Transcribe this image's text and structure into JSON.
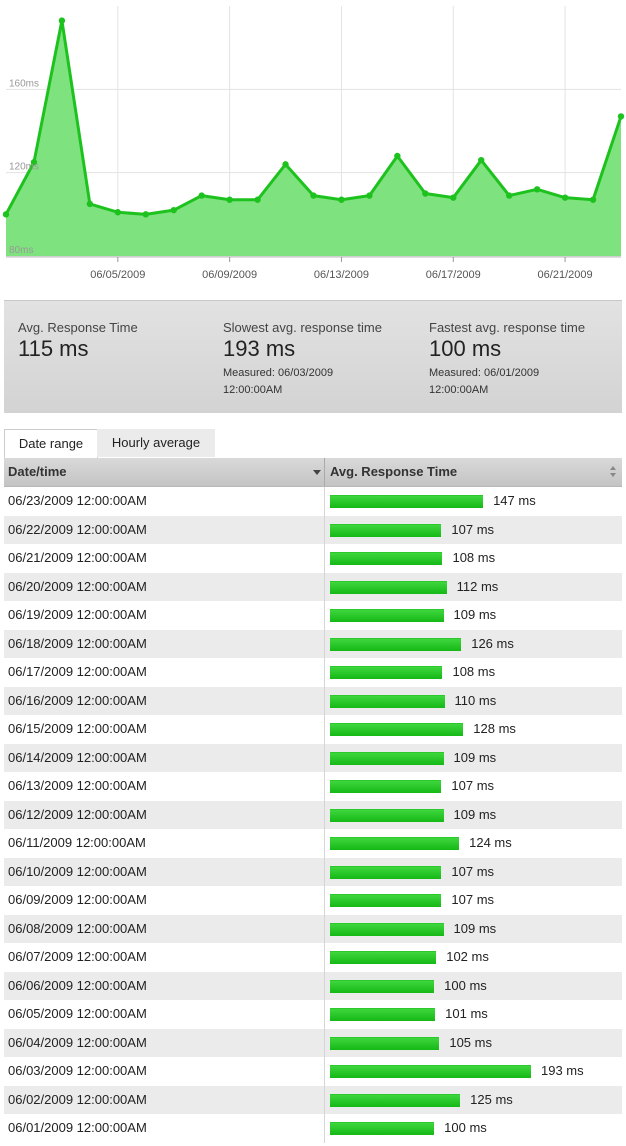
{
  "chart_data": {
    "type": "area",
    "x": [
      "06/01/2009",
      "06/02/2009",
      "06/03/2009",
      "06/04/2009",
      "06/05/2009",
      "06/06/2009",
      "06/07/2009",
      "06/08/2009",
      "06/09/2009",
      "06/10/2009",
      "06/11/2009",
      "06/12/2009",
      "06/13/2009",
      "06/14/2009",
      "06/15/2009",
      "06/16/2009",
      "06/17/2009",
      "06/18/2009",
      "06/19/2009",
      "06/20/2009",
      "06/21/2009",
      "06/22/2009",
      "06/23/2009"
    ],
    "values": [
      100,
      125,
      193,
      105,
      101,
      100,
      102,
      109,
      107,
      107,
      124,
      109,
      107,
      109,
      128,
      110,
      108,
      126,
      109,
      112,
      108,
      107,
      147
    ],
    "xtick_labels": [
      "06/05/2009",
      "06/09/2009",
      "06/13/2009",
      "06/17/2009",
      "06/21/2009"
    ],
    "ytick_labels": [
      "80ms",
      "120ms",
      "160ms"
    ],
    "ylim": [
      80,
      200
    ],
    "grid": true,
    "colors": {
      "line": "#1ec21e",
      "fill": "#7ee27e"
    }
  },
  "summary": {
    "avg": {
      "label": "Avg. Response Time",
      "value": "115 ms"
    },
    "slowest": {
      "label": "Slowest avg. response time",
      "value": "193 ms",
      "measured": "Measured: 06/03/2009",
      "time": "12:00:00AM"
    },
    "fastest": {
      "label": "Fastest avg. response time",
      "value": "100 ms",
      "measured": "Measured: 06/01/2009",
      "time": "12:00:00AM"
    }
  },
  "tabs": {
    "date_range": "Date range",
    "hourly_average": "Hourly average"
  },
  "table": {
    "headers": {
      "datetime": "Date/time",
      "avg": "Avg. Response Time"
    },
    "rows": [
      {
        "date": "06/23/2009 12:00:00AM",
        "value": 147,
        "label": "147 ms"
      },
      {
        "date": "06/22/2009 12:00:00AM",
        "value": 107,
        "label": "107 ms"
      },
      {
        "date": "06/21/2009 12:00:00AM",
        "value": 108,
        "label": "108 ms"
      },
      {
        "date": "06/20/2009 12:00:00AM",
        "value": 112,
        "label": "112 ms"
      },
      {
        "date": "06/19/2009 12:00:00AM",
        "value": 109,
        "label": "109 ms"
      },
      {
        "date": "06/18/2009 12:00:00AM",
        "value": 126,
        "label": "126 ms"
      },
      {
        "date": "06/17/2009 12:00:00AM",
        "value": 108,
        "label": "108 ms"
      },
      {
        "date": "06/16/2009 12:00:00AM",
        "value": 110,
        "label": "110 ms"
      },
      {
        "date": "06/15/2009 12:00:00AM",
        "value": 128,
        "label": "128 ms"
      },
      {
        "date": "06/14/2009 12:00:00AM",
        "value": 109,
        "label": "109 ms"
      },
      {
        "date": "06/13/2009 12:00:00AM",
        "value": 107,
        "label": "107 ms"
      },
      {
        "date": "06/12/2009 12:00:00AM",
        "value": 109,
        "label": "109 ms"
      },
      {
        "date": "06/11/2009 12:00:00AM",
        "value": 124,
        "label": "124 ms"
      },
      {
        "date": "06/10/2009 12:00:00AM",
        "value": 107,
        "label": "107 ms"
      },
      {
        "date": "06/09/2009 12:00:00AM",
        "value": 107,
        "label": "107 ms"
      },
      {
        "date": "06/08/2009 12:00:00AM",
        "value": 109,
        "label": "109 ms"
      },
      {
        "date": "06/07/2009 12:00:00AM",
        "value": 102,
        "label": "102 ms"
      },
      {
        "date": "06/06/2009 12:00:00AM",
        "value": 100,
        "label": "100 ms"
      },
      {
        "date": "06/05/2009 12:00:00AM",
        "value": 101,
        "label": "101 ms"
      },
      {
        "date": "06/04/2009 12:00:00AM",
        "value": 105,
        "label": "105 ms"
      },
      {
        "date": "06/03/2009 12:00:00AM",
        "value": 193,
        "label": "193 ms"
      },
      {
        "date": "06/02/2009 12:00:00AM",
        "value": 125,
        "label": "125 ms"
      },
      {
        "date": "06/01/2009 12:00:00AM",
        "value": 100,
        "label": "100 ms"
      }
    ]
  }
}
